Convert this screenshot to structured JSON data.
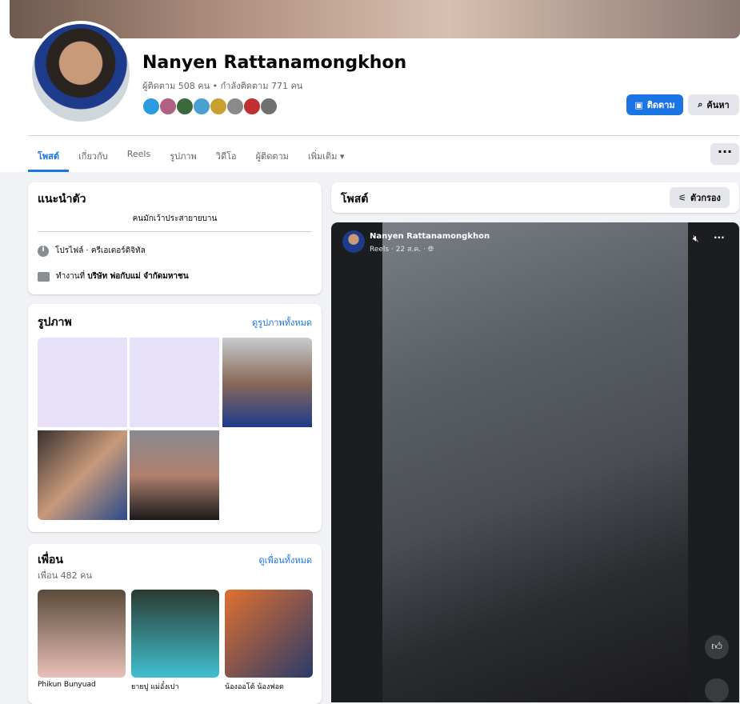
{
  "profile": {
    "name": "Nanyen Rattanamongkhon",
    "stats": "ผู้ติดตาม 508 คน • กำลังติดตาม 771 คน",
    "follow_label": "ติดตาม",
    "search_label": "ค้นหา"
  },
  "tabs": [
    "โพสต์",
    "เกี่ยวกับ",
    "Reels",
    "รูปภาพ",
    "วิดีโอ",
    "ผู้ติดตาม",
    "เพิ่มเติม"
  ],
  "intro": {
    "title": "แนะนำตัว",
    "bio": "คนมักเว้าประสายายบาน",
    "items": [
      "โปรไฟล์ · ครีเอเตอร์ดิจิทัล"
    ],
    "work_prefix": "ทำงานที่ ",
    "work_company": "บริษัท พ่อกับแม่ จำกัดมหาชน"
  },
  "photos": {
    "title": "รูปภาพ",
    "see_all": "ดูรูปภาพทั้งหมด"
  },
  "friends": {
    "title": "เพื่อน",
    "count": "เพื่อน 482 คน",
    "see_all": "ดูเพื่อนทั้งหมด",
    "list": [
      "Phikun Bunyuad",
      "ยายปู แม่อั๋งเปา",
      "น้องออโต้ น้องฟอด"
    ]
  },
  "posts": {
    "title": "โพสต์",
    "filter_label": "ตัวกรอง"
  },
  "post": {
    "author": "Nanyen Rattanamongkhon",
    "meta": "Reels · 22 ส.ค. · "
  },
  "colors": {
    "accent": "#1b74e4"
  }
}
